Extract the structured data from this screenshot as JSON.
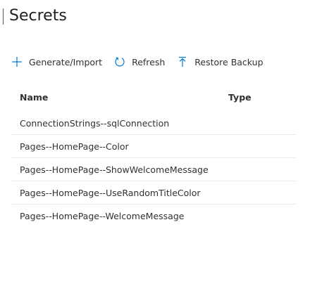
{
  "page": {
    "title": "Secrets"
  },
  "toolbar": {
    "generate_import": {
      "label": "Generate/Import",
      "icon": "plus-icon"
    },
    "refresh": {
      "label": "Refresh",
      "icon": "refresh-icon"
    },
    "restore_backup": {
      "label": "Restore Backup",
      "icon": "upload-arrow-icon"
    }
  },
  "colors": {
    "accent": "#0078d4",
    "text": "#323130",
    "divider": "#edebe9"
  },
  "table": {
    "columns": [
      "Name",
      "Type"
    ],
    "rows": [
      {
        "name": "ConnectionStrings--sqlConnection",
        "type": ""
      },
      {
        "name": "Pages--HomePage--Color",
        "type": ""
      },
      {
        "name": "Pages--HomePage--ShowWelcomeMessage",
        "type": ""
      },
      {
        "name": "Pages--HomePage--UseRandomTitleColor",
        "type": ""
      },
      {
        "name": "Pages--HomePage--WelcomeMessage",
        "type": ""
      }
    ]
  }
}
